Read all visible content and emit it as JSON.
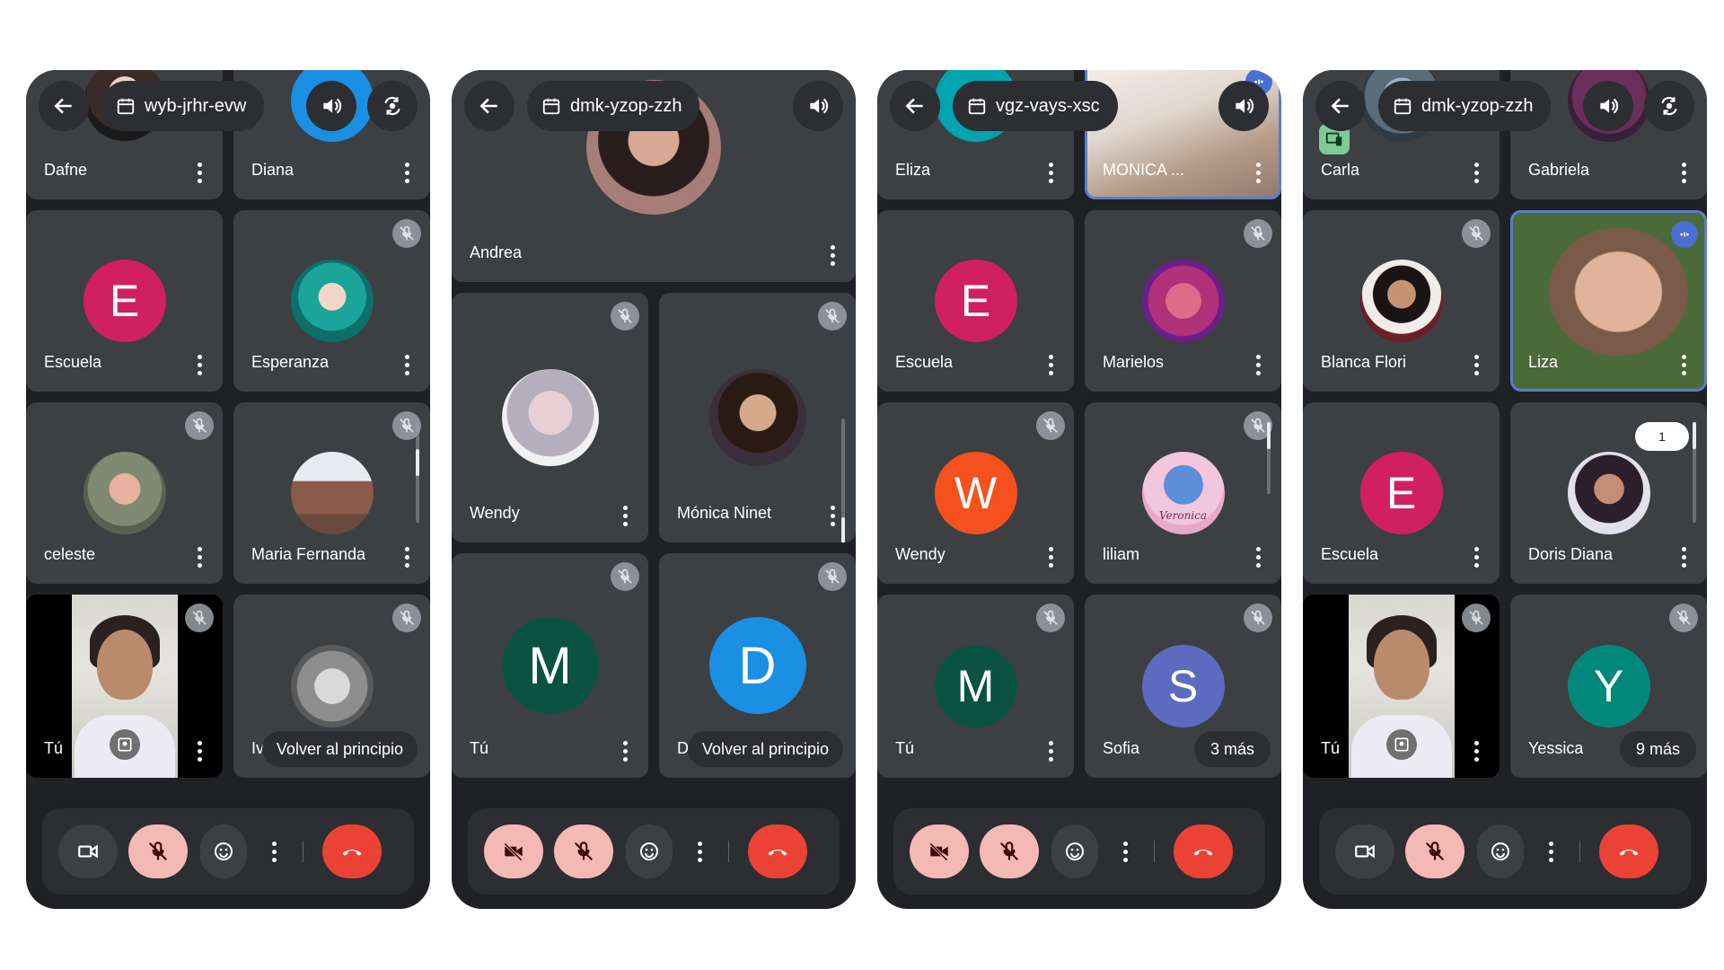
{
  "common": {
    "you_label": "Tú",
    "back_to_start_label": "Volver al principio",
    "colors": {
      "background": "#202124",
      "tile": "#3c4043",
      "end_call": "#ea4335",
      "muted_control": "#f4b8b5",
      "speaking_outline": "#5b7ccf"
    },
    "icons": [
      "back-arrow-icon",
      "calendar-icon",
      "speaker-icon",
      "switch-camera-icon",
      "mic-off-icon",
      "more-vert-icon",
      "camera-icon",
      "camera-off-icon",
      "emoji-icon",
      "end-call-icon",
      "pin-icon"
    ]
  },
  "phones": [
    {
      "meeting_code": "wyb-jrhr-evw",
      "participants": [
        "Dafne",
        "Diana",
        "Escuela",
        "Esperanza",
        "celeste",
        "Maria Fernanda",
        "Tú",
        "Iv"
      ],
      "partial_label": "Iv",
      "back_chip": "Volver al principio"
    },
    {
      "meeting_code": "dmk-yzop-zzh",
      "participants": [
        "Andrea",
        "Wendy",
        "Mónica Ninet",
        "Tú",
        "Di"
      ],
      "partial_label": "Di",
      "back_chip": "Volver al principio"
    },
    {
      "meeting_code": "vgz-vays-xsc",
      "participants": [
        "Eliza",
        "MONICA ...",
        "Escuela",
        "Marielos",
        "Wendy",
        "liliam",
        "Tú",
        "Sofia"
      ],
      "more_chip": "3 más",
      "avatar_caption": "Veronica"
    },
    {
      "meeting_code": "dmk-yzop-zzh",
      "participants": [
        "Carla",
        "Gabriela",
        "Blanca Flori",
        "Liza",
        "Escuela",
        "Doris Diana",
        "Tú",
        "Yessica"
      ],
      "more_chip": "9 más",
      "count_badge": "1"
    }
  ],
  "avatar_letters": {
    "diana": "D",
    "escuela": "E",
    "wendy": "W",
    "tu_m": "M",
    "di": "D",
    "eliza": "E",
    "sofia": "S",
    "yessica": "Y"
  }
}
